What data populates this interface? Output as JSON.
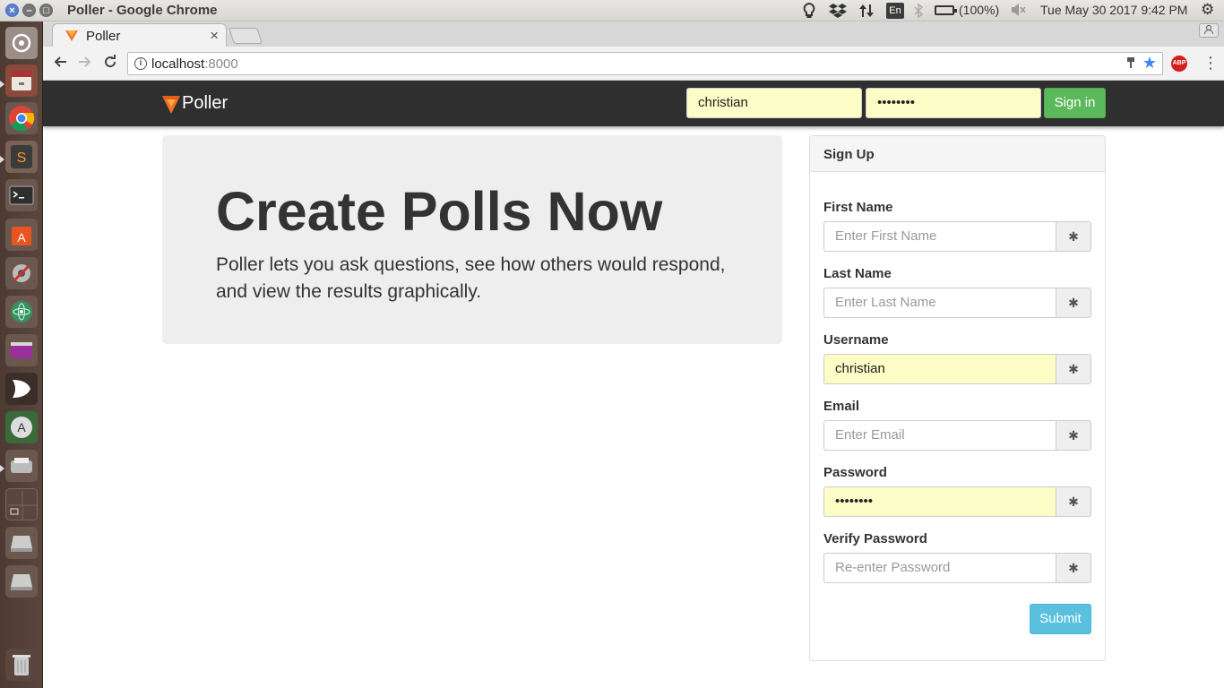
{
  "os_panel": {
    "window_title": "Poller - Google Chrome",
    "input_method": "En",
    "battery": "(100%)",
    "clock": "Tue May 30 2017  9:42 PM"
  },
  "browser": {
    "tab_title": "Poller",
    "tab_close": "×",
    "url_host": "localhost",
    "url_port": ":8000",
    "abp_label": "ABP"
  },
  "navbar": {
    "brand": "Poller",
    "username_value": "christian",
    "password_value": "••••••••",
    "signin_label": "Sign in"
  },
  "jumbotron": {
    "title": "Create Polls Now",
    "text": "Poller lets you ask questions, see how others would respond, and view the results graphically."
  },
  "signup": {
    "heading": "Sign Up",
    "fields": [
      {
        "label": "First Name",
        "placeholder": "Enter First Name",
        "value": ""
      },
      {
        "label": "Last Name",
        "placeholder": "Enter Last Name",
        "value": ""
      },
      {
        "label": "Username",
        "placeholder": "",
        "value": "christian"
      },
      {
        "label": "Email",
        "placeholder": "Enter Email",
        "value": ""
      },
      {
        "label": "Password",
        "placeholder": "",
        "value": "••••••••"
      },
      {
        "label": "Verify Password",
        "placeholder": "Re-enter Password",
        "value": ""
      }
    ],
    "addon_icon": "asterisk-icon",
    "submit_label": "Submit"
  },
  "colors": {
    "navbar": "#2f2f2f",
    "autofill": "#fbfcc6",
    "success": "#5cb85c",
    "info": "#5bc0de"
  }
}
